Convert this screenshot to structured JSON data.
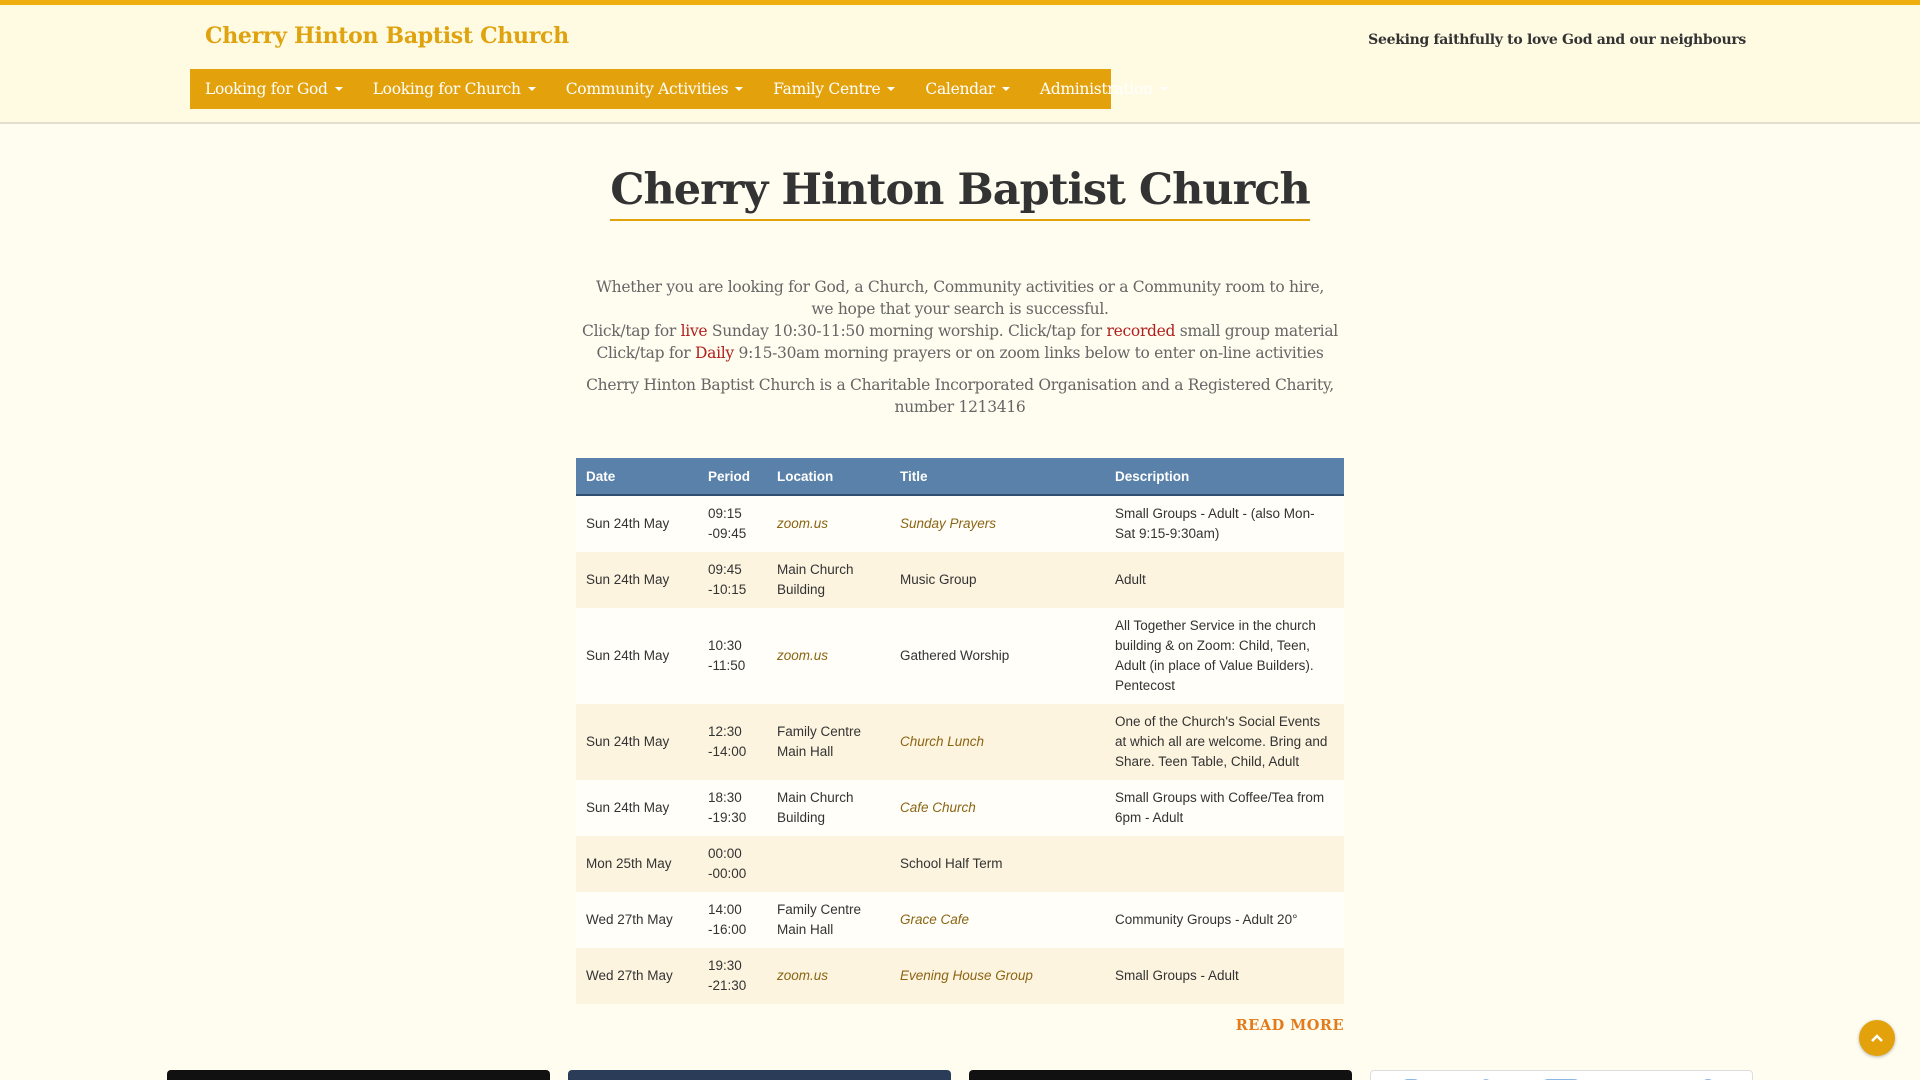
{
  "header": {
    "site_title": "Cherry Hinton Baptist Church",
    "tagline": "Seeking faithfully to love God and our neighbours",
    "nav": [
      {
        "label": "Looking for God"
      },
      {
        "label": "Looking for Church"
      },
      {
        "label": "Community Activities"
      },
      {
        "label": "Family Centre"
      },
      {
        "label": "Calendar"
      },
      {
        "label": "Administration"
      }
    ]
  },
  "main": {
    "title": "Cherry Hinton Baptist Church",
    "intro": {
      "line1": "Whether you are looking for God, a Church, Community activities or a Community room to hire,",
      "line2": "we hope that your search is successful.",
      "line3_a": "Click/tap for ",
      "line3_link1": "live",
      "line3_b": " Sunday 10:30-11:50 morning worship. Click/tap for ",
      "line3_link2": "recorded",
      "line3_c": " small group material",
      "line4_a": "Click/tap for ",
      "line4_link": "Daily",
      "line4_b": " 9:15-30am morning prayers  or on zoom links below to enter on-line activities",
      "charity_line1": "Cherry Hinton Baptist Church is a Charitable Incorporated Organisation and a Registered Charity,",
      "charity_line2": "number 1213416"
    },
    "table": {
      "headers": [
        "Date",
        "Period",
        "Location",
        "Title",
        "Description"
      ],
      "rows": [
        {
          "date": "Sun 24th May",
          "period_start": "09:15",
          "period_end": "-09:45",
          "location": "zoom.us",
          "location_link": true,
          "title": "Sunday Prayers",
          "title_link": true,
          "description": "Small Groups - Adult - (also Mon-Sat 9:15-9:30am)"
        },
        {
          "date": "Sun 24th May",
          "period_start": "09:45",
          "period_end": "-10:15",
          "location": "Main Church Building",
          "location_link": false,
          "title": "Music Group",
          "title_link": false,
          "description": "Adult"
        },
        {
          "date": "Sun 24th May",
          "period_start": "10:30",
          "period_end": "-11:50",
          "location": "zoom.us",
          "location_link": true,
          "title": "Gathered Worship",
          "title_link": false,
          "description": "All Together Service  in the church building & on Zoom: Child, Teen, Adult (in place of Value Builders). Pentecost"
        },
        {
          "date": "Sun 24th May",
          "period_start": "12:30",
          "period_end": "-14:00",
          "location": "Family Centre Main Hall",
          "location_link": false,
          "title": "Church Lunch",
          "title_link": true,
          "description": "One of the Church's Social Events at which all are welcome.  Bring and Share. Teen Table, Child, Adult"
        },
        {
          "date": "Sun 24th May",
          "period_start": "18:30",
          "period_end": "-19:30",
          "location": "Main Church Building",
          "location_link": false,
          "title": "Cafe Church",
          "title_link": true,
          "description": "Small Groups with Coffee/Tea from 6pm - Adult"
        },
        {
          "date": "Mon 25th May",
          "period_start": "00:00",
          "period_end": "-00:00",
          "location": "",
          "location_link": false,
          "title": "School Half Term",
          "title_link": false,
          "description": ""
        },
        {
          "date": "Wed 27th May",
          "period_start": "14:00",
          "period_end": "-16:00",
          "location": "Family Centre Main Hall",
          "location_link": false,
          "title": "Grace Cafe",
          "title_link": true,
          "description": "Community Groups - Adult  20°"
        },
        {
          "date": "Wed 27th May",
          "period_start": "19:30",
          "period_end": "-21:30",
          "location": "zoom.us",
          "location_link": true,
          "title": "Evening House Group",
          "title_link": true,
          "description": "Small Groups - Adult"
        }
      ]
    },
    "read_more": "READ MORE"
  },
  "icons": {
    "scroll_top": "chevron-up-icon",
    "nav_caret": "caret-down-icon"
  },
  "colors": {
    "accent": "#e3a20c",
    "title_gold": "#e0a310",
    "link_red": "#b01e1e",
    "table_header": "#5a81a9",
    "read_more": "#e37a1c"
  }
}
